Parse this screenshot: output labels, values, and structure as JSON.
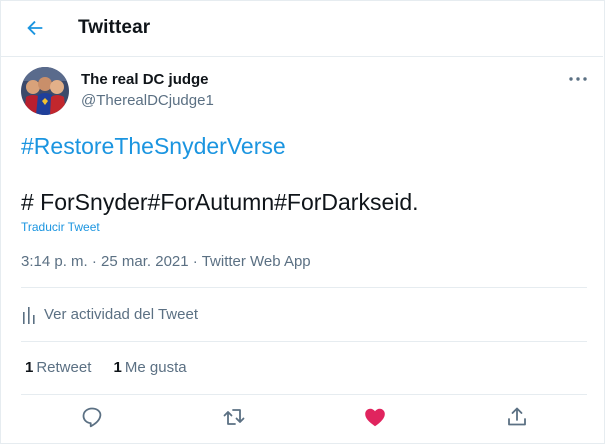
{
  "header": {
    "title": "Twittear"
  },
  "tweet": {
    "author_name": "The real DC judge",
    "author_handle": "@TherealDCjudge1",
    "line1": "#RestoreTheSnyderVerse",
    "line2": "# ForSnyder#ForAutumn#ForDarkseid.",
    "translate_label": "Traducir Tweet",
    "time": "3:14 p. m.",
    "date": "25 mar. 2021",
    "separator": "·",
    "source": "Twitter Web App"
  },
  "activity": {
    "label": "Ver actividad del Tweet"
  },
  "stats": {
    "retweets_count": "1",
    "retweets_label": "Retweet",
    "likes_count": "1",
    "likes_label": "Me gusta"
  },
  "actions": {
    "reply_icon": "reply-icon",
    "retweet_icon": "retweet-icon",
    "like_icon": "heart-filled-icon",
    "share_icon": "share-icon"
  },
  "colors": {
    "accent": "#1b95e0",
    "like": "#e0245e",
    "secondary_text": "#5b7083",
    "border": "#e6ecf0"
  }
}
